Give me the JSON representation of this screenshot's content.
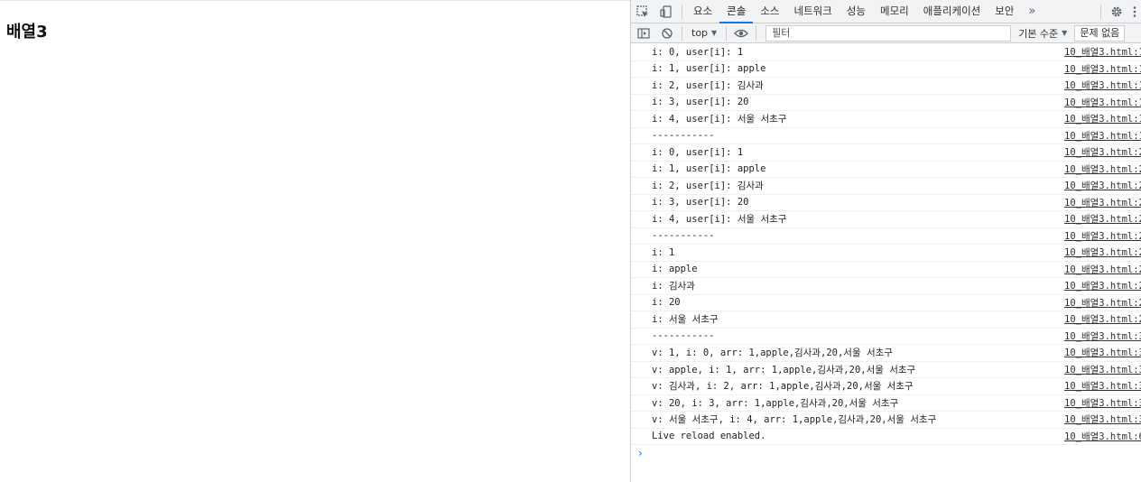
{
  "page": {
    "heading": "배열3"
  },
  "devtools": {
    "tabs": [
      "요소",
      "콘솔",
      "소스",
      "네트워크",
      "성능",
      "메모리",
      "애플리케이션",
      "보안"
    ],
    "active_tab": "콘솔",
    "more_tabs": "»",
    "context": "top",
    "filter_placeholder": "필터",
    "levels": "기본 수준",
    "issues": "문제 없음"
  },
  "console": {
    "lines": [
      {
        "message": "i: 0, user[i]: 1",
        "source": "10_배열3.html:1"
      },
      {
        "message": "i: 1, user[i]: apple",
        "source": "10_배열3.html:1"
      },
      {
        "message": "i: 2, user[i]: 김사과",
        "source": "10_배열3.html:1"
      },
      {
        "message": "i: 3, user[i]: 20",
        "source": "10_배열3.html:1"
      },
      {
        "message": "i: 4, user[i]: 서울 서초구",
        "source": "10_배열3.html:1"
      },
      {
        "message": "-----------",
        "source": "10_배열3.html:1"
      },
      {
        "message": "i: 0, user[i]: 1",
        "source": "10_배열3.html:2"
      },
      {
        "message": "i: 1, user[i]: apple",
        "source": "10_배열3.html:2"
      },
      {
        "message": "i: 2, user[i]: 김사과",
        "source": "10_배열3.html:2"
      },
      {
        "message": "i: 3, user[i]: 20",
        "source": "10_배열3.html:2"
      },
      {
        "message": "i: 4, user[i]: 서울 서초구",
        "source": "10_배열3.html:2"
      },
      {
        "message": "-----------",
        "source": "10_배열3.html:2"
      },
      {
        "message": "i: 1",
        "source": "10_배열3.html:2"
      },
      {
        "message": "i: apple",
        "source": "10_배열3.html:2"
      },
      {
        "message": "i: 김사과",
        "source": "10_배열3.html:2"
      },
      {
        "message": "i: 20",
        "source": "10_배열3.html:2"
      },
      {
        "message": "i: 서울 서초구",
        "source": "10_배열3.html:2"
      },
      {
        "message": "-----------",
        "source": "10_배열3.html:3"
      },
      {
        "message": "v: 1, i: 0, arr: 1,apple,김사과,20,서울 서초구",
        "source": "10_배열3.html:3"
      },
      {
        "message": "v: apple, i: 1, arr: 1,apple,김사과,20,서울 서초구",
        "source": "10_배열3.html:3"
      },
      {
        "message": "v: 김사과, i: 2, arr: 1,apple,김사과,20,서울 서초구",
        "source": "10_배열3.html:3"
      },
      {
        "message": "v: 20, i: 3, arr: 1,apple,김사과,20,서울 서초구",
        "source": "10_배열3.html:3"
      },
      {
        "message": "v: 서울 서초구, i: 4, arr: 1,apple,김사과,20,서울 서초구",
        "source": "10_배열3.html:3"
      },
      {
        "message": "Live reload enabled.",
        "source": "10_배열3.html:6"
      }
    ],
    "prompt": "›"
  }
}
